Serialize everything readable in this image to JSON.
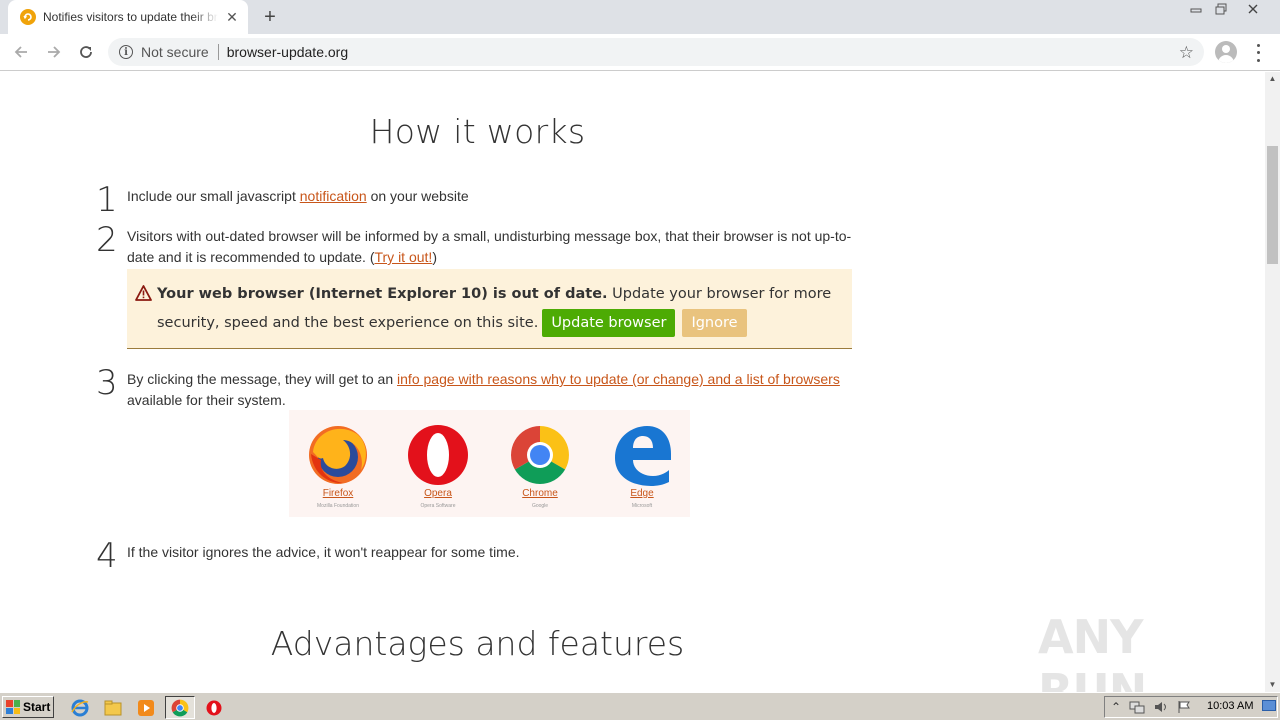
{
  "browser": {
    "tab_title": "Notifies visitors to update their browser",
    "tab_close": "✕",
    "new_tab": "+",
    "security_label": "Not secure",
    "url": "browser-update.org"
  },
  "page": {
    "heading": "How it works",
    "steps": [
      {
        "num": "1",
        "pre": "Include our small javascript ",
        "link": "notification",
        "post": " on your website"
      },
      {
        "num": "2",
        "pre": "Visitors with out-dated browser will be informed by a small, undisturbing message box, that their browser is not up-to-date and it is recommended to update. (",
        "link": "Try it out!",
        "post": ")"
      },
      {
        "num": "3",
        "pre": "By clicking the message, they will get to an ",
        "link": "info page with reasons why to update (or change) and a list of browsers",
        "post": " available for their system."
      },
      {
        "num": "4",
        "text": "If the visitor ignores the advice, it won't reappear for some time."
      }
    ],
    "notice": {
      "bold": "Your web browser (Internet Explorer 10) is out of date.",
      "text": " Update your browser for more security, speed and the best experience on this site.",
      "update_label": "Update browser",
      "ignore_label": "Ignore"
    },
    "browsers": [
      {
        "name": "Firefox",
        "vendor": "Mozilla Foundation"
      },
      {
        "name": "Opera",
        "vendor": "Opera Software"
      },
      {
        "name": "Chrome",
        "vendor": "Google"
      },
      {
        "name": "Edge",
        "vendor": "Microsoft"
      }
    ],
    "heading2": "Advantages and features",
    "watermark": "ANY RUN"
  },
  "taskbar": {
    "start_label": "Start",
    "clock": "10:03 AM"
  },
  "colors": {
    "link": "#c8561a",
    "update_button": "#4dab04",
    "ignore_button": "#e9c37e",
    "notice_bg": "#fdf2db"
  }
}
